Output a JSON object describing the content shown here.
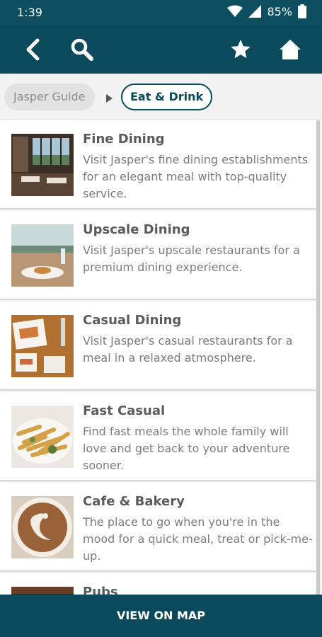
{
  "status_bar": {
    "time": "1:39",
    "battery": "85%"
  },
  "app_bar": {
    "icons": [
      "back-icon",
      "search-icon",
      "star-icon",
      "home-icon"
    ],
    "color": "#0b4a5c"
  },
  "breadcrumb": {
    "home": "Jasper Guide",
    "current": "Eat & Drink"
  },
  "categories": [
    {
      "title": "Fine Dining",
      "description": "Visit Jasper's fine dining establishments for an elegant meal with top-quality service."
    },
    {
      "title": "Upscale Dining",
      "description": "Visit Jasper's upscale restaurants for a premium dining experience."
    },
    {
      "title": "Casual Dining",
      "description": "Visit Jasper's casual restaurants for a meal in a relaxed atmosphere."
    },
    {
      "title": "Fast Casual",
      "description": "Find fast meals the whole family will love and get back to your adventure sooner."
    },
    {
      "title": "Cafe & Bakery",
      "description": "The place to go when you're in the mood for a quick meal, treat or pick-me-up."
    },
    {
      "title": "Pubs",
      "description": ""
    }
  ],
  "bottom_button": {
    "label": "VIEW ON MAP"
  }
}
